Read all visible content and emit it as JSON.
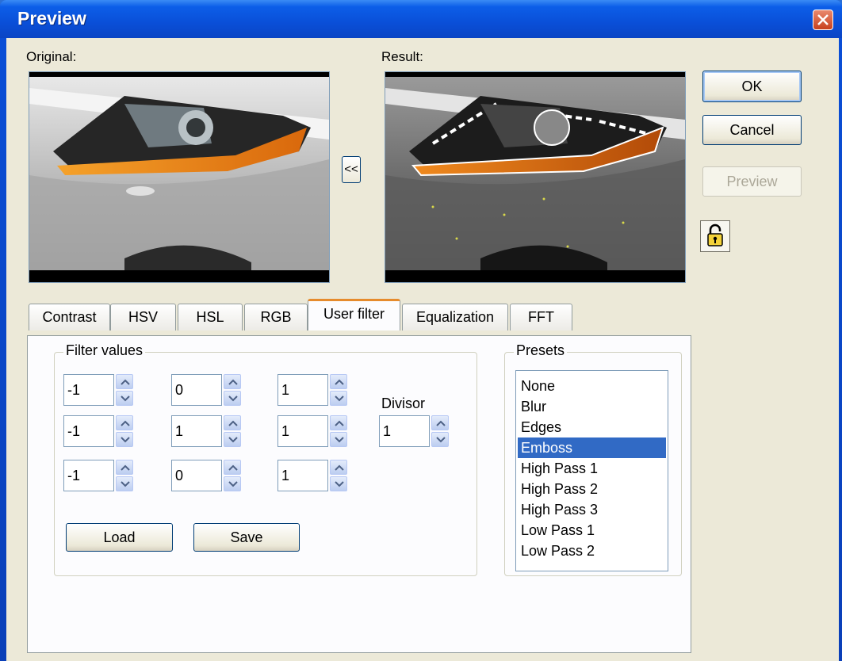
{
  "window": {
    "title": "Preview"
  },
  "labels": {
    "original": "Original:",
    "result": "Result:"
  },
  "buttons": {
    "ok": "OK",
    "cancel": "Cancel",
    "preview": "Preview",
    "copy_back": "<<",
    "load": "Load",
    "save": "Save"
  },
  "tabs": [
    {
      "label": "Contrast"
    },
    {
      "label": "HSV"
    },
    {
      "label": "HSL"
    },
    {
      "label": "RGB"
    },
    {
      "label": "User filter",
      "active": true
    },
    {
      "label": "Equalization"
    },
    {
      "label": "FFT"
    }
  ],
  "filter": {
    "group_title": "Filter values",
    "matrix": [
      [
        "-1",
        "0",
        "1"
      ],
      [
        "-1",
        "1",
        "1"
      ],
      [
        "-1",
        "0",
        "1"
      ]
    ],
    "divisor_label": "Divisor",
    "divisor": "1"
  },
  "presets": {
    "group_title": "Presets",
    "items": [
      "None",
      "Blur",
      "Edges",
      "Emboss",
      "High Pass 1",
      "High Pass 2",
      "High Pass 3",
      "Low Pass 1",
      "Low Pass 2"
    ],
    "selected": "Emboss"
  },
  "icons": {
    "lock": "lock-icon",
    "close": "close-icon"
  },
  "colors": {
    "selection": "#316ac5",
    "title_bar": "#0a4fd8",
    "active_tab_accent": "#e68b2c"
  }
}
